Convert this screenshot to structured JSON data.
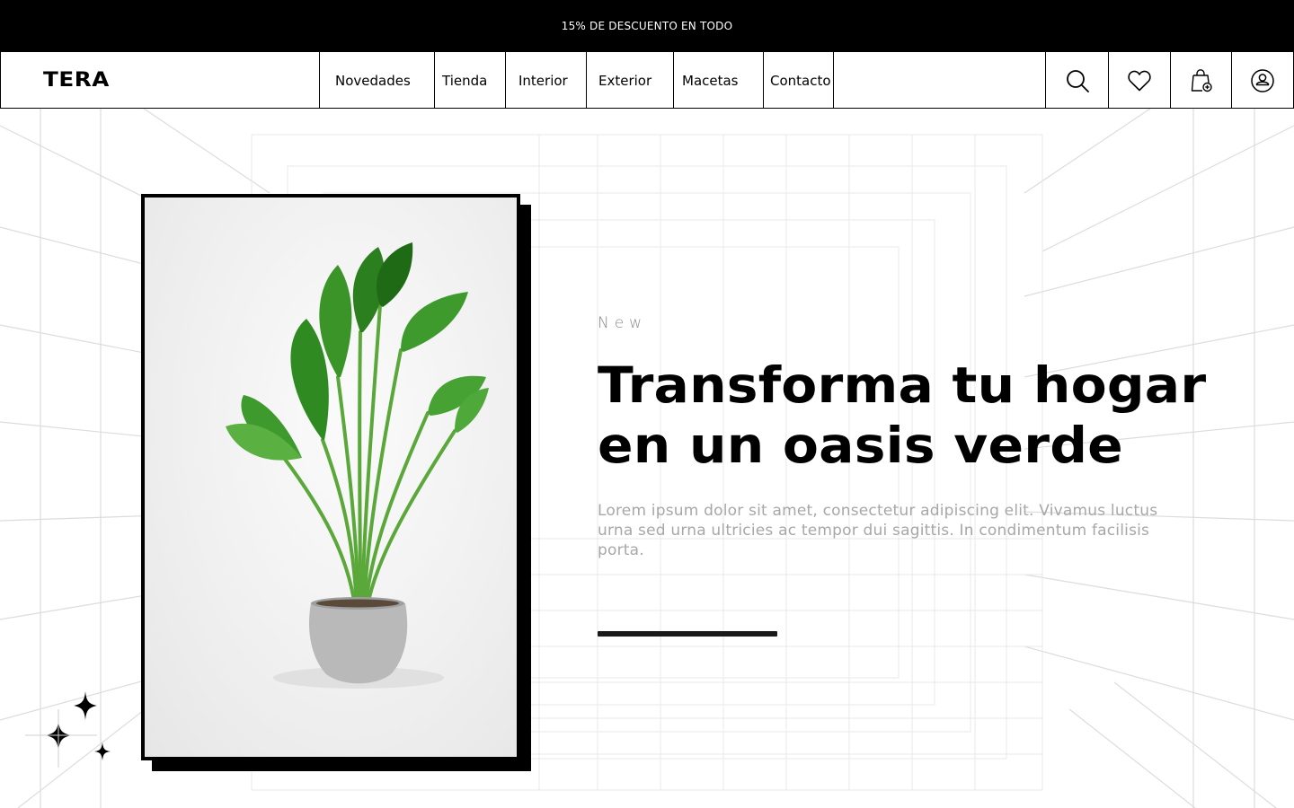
{
  "promo_bar": {
    "text": "15% DE DESCUENTO EN TODO"
  },
  "brand": {
    "name": "TERA"
  },
  "nav": {
    "items": [
      {
        "label": "Novedades"
      },
      {
        "label": "Tienda"
      },
      {
        "label": "Interior"
      },
      {
        "label": "Exterior"
      },
      {
        "label": "Macetas"
      },
      {
        "label": "Contacto"
      }
    ],
    "icons": [
      "search-icon",
      "heart-icon",
      "shopping-bag-icon",
      "user-icon"
    ]
  },
  "hero": {
    "eyebrow": "New",
    "headline": "Transforma tu hogar\nen un oasis verde",
    "body": "Lorem ipsum dolor sit amet, consectetur adipiscing elit. Vivamus luctus urna sed urna ultricies ac tempor dui sagittis. In condimentum facilisis porta.",
    "image_subject": "potted banana plant in grey concrete pot"
  },
  "colors": {
    "promo_background": "#000000",
    "promo_text": "#ffffff",
    "body_copy": "#a7a7a7",
    "grid_lines": "#d9d9d9",
    "leaf_green": "#3f9a2e"
  }
}
